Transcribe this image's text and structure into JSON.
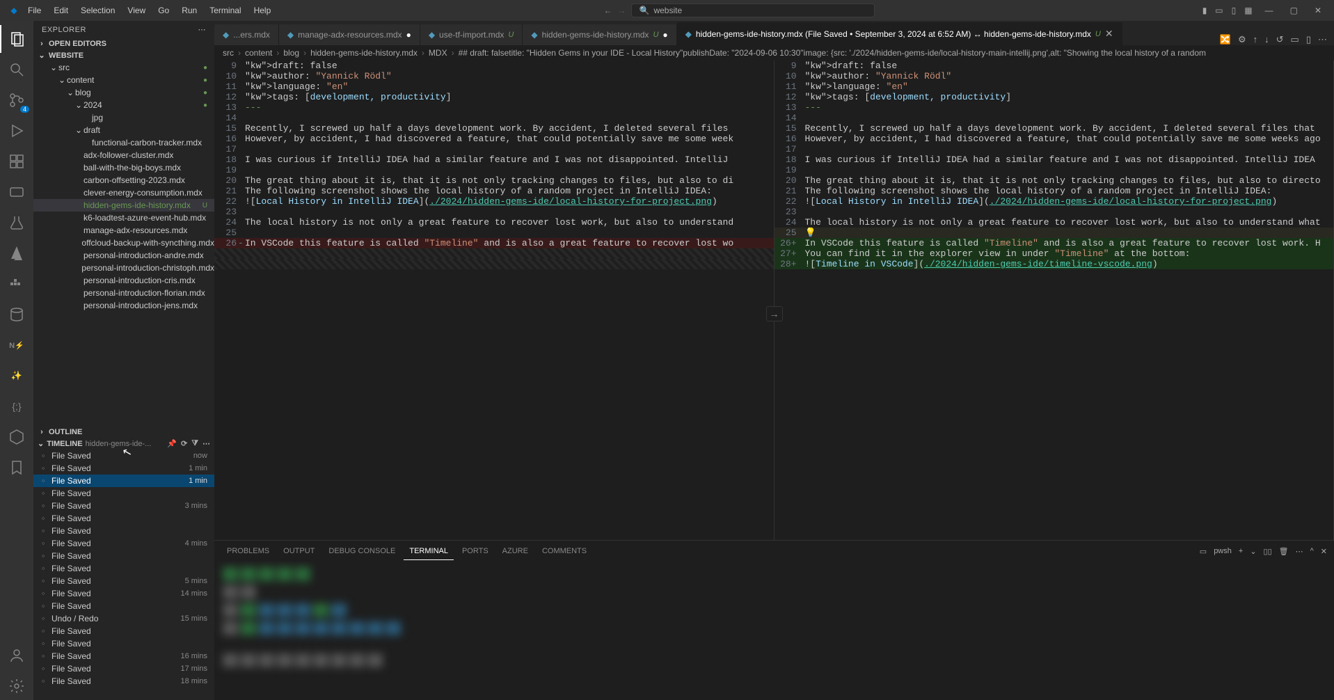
{
  "titlebar": {
    "menu": [
      "File",
      "Edit",
      "Selection",
      "View",
      "Go",
      "Run",
      "Terminal",
      "Help"
    ],
    "search_text": "website"
  },
  "sidebar": {
    "title": "EXPLORER",
    "sections": {
      "open_editors": "OPEN EDITORS",
      "workspace": "WEBSITE",
      "outline": "OUTLINE",
      "timeline": "TIMELINE"
    },
    "tree": [
      {
        "depth": 1,
        "chev": "v",
        "label": "src",
        "dot": true
      },
      {
        "depth": 2,
        "chev": "v",
        "label": "content",
        "dot": true
      },
      {
        "depth": 3,
        "chev": "v",
        "label": "blog",
        "dot": true
      },
      {
        "depth": 4,
        "chev": "v",
        "label": "2024",
        "dot": true
      },
      {
        "depth": 5,
        "chev": "",
        "label": "jpg"
      },
      {
        "depth": 4,
        "chev": "v",
        "label": "draft"
      },
      {
        "depth": 5,
        "chev": "",
        "label": "functional-carbon-tracker.mdx"
      },
      {
        "depth": 4,
        "chev": "",
        "label": "adx-follower-cluster.mdx"
      },
      {
        "depth": 4,
        "chev": "",
        "label": "ball-with-the-big-boys.mdx"
      },
      {
        "depth": 4,
        "chev": "",
        "label": "carbon-offsetting-2023.mdx"
      },
      {
        "depth": 4,
        "chev": "",
        "label": "clever-energy-consumption.mdx"
      },
      {
        "depth": 4,
        "chev": "",
        "label": "hidden-gems-ide-history.mdx",
        "selected": true,
        "git": "U"
      },
      {
        "depth": 4,
        "chev": "",
        "label": "k6-loadtest-azure-event-hub.mdx"
      },
      {
        "depth": 4,
        "chev": "",
        "label": "manage-adx-resources.mdx"
      },
      {
        "depth": 4,
        "chev": "",
        "label": "offcloud-backup-with-syncthing.mdx"
      },
      {
        "depth": 4,
        "chev": "",
        "label": "personal-introduction-andre.mdx"
      },
      {
        "depth": 4,
        "chev": "",
        "label": "personal-introduction-christoph.mdx"
      },
      {
        "depth": 4,
        "chev": "",
        "label": "personal-introduction-cris.mdx"
      },
      {
        "depth": 4,
        "chev": "",
        "label": "personal-introduction-florian.mdx"
      },
      {
        "depth": 4,
        "chev": "",
        "label": "personal-introduction-jens.mdx"
      }
    ],
    "timeline_file": "hidden-gems-ide-...",
    "timeline": [
      {
        "label": "File Saved",
        "time": "now"
      },
      {
        "label": "File Saved",
        "time": "1 min"
      },
      {
        "label": "File Saved",
        "time": "1 min",
        "selected": true
      },
      {
        "label": "File Saved",
        "time": ""
      },
      {
        "label": "File Saved",
        "time": "3 mins"
      },
      {
        "label": "File Saved",
        "time": ""
      },
      {
        "label": "File Saved",
        "time": ""
      },
      {
        "label": "File Saved",
        "time": "4 mins"
      },
      {
        "label": "File Saved",
        "time": ""
      },
      {
        "label": "File Saved",
        "time": ""
      },
      {
        "label": "File Saved",
        "time": "5 mins"
      },
      {
        "label": "File Saved",
        "time": "14 mins"
      },
      {
        "label": "File Saved",
        "time": ""
      },
      {
        "label": "Undo / Redo",
        "time": "15 mins"
      },
      {
        "label": "File Saved",
        "time": ""
      },
      {
        "label": "File Saved",
        "time": ""
      },
      {
        "label": "File Saved",
        "time": "16 mins"
      },
      {
        "label": "File Saved",
        "time": "17 mins"
      },
      {
        "label": "File Saved",
        "time": "18 mins"
      }
    ]
  },
  "tabs": [
    {
      "label": "...ers.mdx",
      "active": false
    },
    {
      "label": "manage-adx-resources.mdx",
      "active": false,
      "dot": true
    },
    {
      "label": "use-tf-import.mdx",
      "status": "U",
      "active": false
    },
    {
      "label": "hidden-gems-ide-history.mdx",
      "status": "U",
      "active": false,
      "dot": true
    },
    {
      "label": "hidden-gems-ide-history.mdx (File Saved • September 3, 2024 at 6:52 AM) ↔ hidden-gems-ide-history.mdx",
      "status": "U",
      "active": true
    }
  ],
  "breadcrumb": [
    "src",
    "content",
    "blog",
    "hidden-gems-ide-history.mdx",
    "MDX",
    "## draft: falsetitle: \"Hidden Gems in your IDE - Local History\"publishDate: \"2024-09-06 10:30\"image: {src: './2024/hidden-gems-ide/local-history-main-intellij.png',alt: \"Showing the local history of a random"
  ],
  "editor": {
    "left": [
      {
        "n": 9,
        "text": "draft: false",
        "cls": ""
      },
      {
        "n": 10,
        "text": "author: \"Yannick Rödl\"",
        "cls": ""
      },
      {
        "n": 11,
        "text": "language: \"en\"",
        "cls": ""
      },
      {
        "n": 12,
        "text": "tags: [development, productivity]",
        "cls": ""
      },
      {
        "n": 13,
        "text": "---",
        "cls": ""
      },
      {
        "n": 14,
        "text": "",
        "cls": ""
      },
      {
        "n": 15,
        "text": "Recently, I screwed up half a days development work. By accident, I deleted several files",
        "cls": ""
      },
      {
        "n": 16,
        "text": "However, by accident, I had discovered a feature, that could potentially save me some week",
        "cls": ""
      },
      {
        "n": 17,
        "text": "",
        "cls": ""
      },
      {
        "n": 18,
        "text": "I was curious if IntelliJ IDEA had a similar feature and I was not disappointed. IntelliJ",
        "cls": ""
      },
      {
        "n": 19,
        "text": "",
        "cls": ""
      },
      {
        "n": 20,
        "text": "The great thing about it is, that it is not only tracking changes to files, but also to di",
        "cls": ""
      },
      {
        "n": 21,
        "text": "The following screenshot shows the local history of a random project in IntelliJ IDEA:",
        "cls": ""
      },
      {
        "n": 22,
        "text": "![Local History in IntelliJ IDEA](./2024/hidden-gems-ide/local-history-for-project.png)",
        "cls": ""
      },
      {
        "n": 23,
        "text": "",
        "cls": ""
      },
      {
        "n": 24,
        "text": "The local history is not only a great feature to recover lost work, but also to understand",
        "cls": ""
      },
      {
        "n": 25,
        "text": "",
        "cls": ""
      },
      {
        "n": 26,
        "text": "In VSCode this feature is called \"Timeline\" and is also a great feature to recover lost wo",
        "cls": "removed"
      },
      {
        "n": "",
        "text": "",
        "cls": "diag"
      },
      {
        "n": "",
        "text": "",
        "cls": "diag"
      }
    ],
    "right": [
      {
        "n": 9,
        "text": "draft: false",
        "cls": ""
      },
      {
        "n": 10,
        "text": "author: \"Yannick Rödl\"",
        "cls": ""
      },
      {
        "n": 11,
        "text": "language: \"en\"",
        "cls": ""
      },
      {
        "n": 12,
        "text": "tags: [development, productivity]",
        "cls": ""
      },
      {
        "n": 13,
        "text": "---",
        "cls": ""
      },
      {
        "n": 14,
        "text": "",
        "cls": ""
      },
      {
        "n": 15,
        "text": "Recently, I screwed up half a days development work. By accident, I deleted several files that",
        "cls": ""
      },
      {
        "n": 16,
        "text": "However, by accident, I had discovered a feature, that could potentially save me some weeks ago",
        "cls": ""
      },
      {
        "n": 17,
        "text": "",
        "cls": ""
      },
      {
        "n": 18,
        "text": "I was curious if IntelliJ IDEA had a similar feature and I was not disappointed. IntelliJ IDEA",
        "cls": ""
      },
      {
        "n": 19,
        "text": "",
        "cls": ""
      },
      {
        "n": 20,
        "text": "The great thing about it is, that it is not only tracking changes to files, but also to directo",
        "cls": ""
      },
      {
        "n": 21,
        "text": "The following screenshot shows the local history of a random project in IntelliJ IDEA:",
        "cls": ""
      },
      {
        "n": 22,
        "text": "![Local History in IntelliJ IDEA](./2024/hidden-gems-ide/local-history-for-project.png)",
        "cls": ""
      },
      {
        "n": 23,
        "text": "",
        "cls": ""
      },
      {
        "n": 24,
        "text": "The local history is not only a great feature to recover lost work, but also to understand what",
        "cls": ""
      },
      {
        "n": 25,
        "text": "💡",
        "cls": "idea"
      },
      {
        "n": 26,
        "text": "In VSCode this feature is called \"Timeline\" and is also a great feature to recover lost work. H",
        "cls": "added",
        "plus": true
      },
      {
        "n": 27,
        "text": "You can find it in the explorer view in under \"Timeline\" at the bottom:",
        "cls": "added",
        "plus": true
      },
      {
        "n": 28,
        "text": "![Timeline in VSCode](./2024/hidden-gems-ide/timeline-vscode.png)",
        "cls": "added",
        "plus": true
      }
    ]
  },
  "panel": {
    "tabs": [
      "PROBLEMS",
      "OUTPUT",
      "DEBUG CONSOLE",
      "TERMINAL",
      "PORTS",
      "AZURE",
      "COMMENTS"
    ],
    "active": "TERMINAL",
    "shell": "pwsh"
  }
}
